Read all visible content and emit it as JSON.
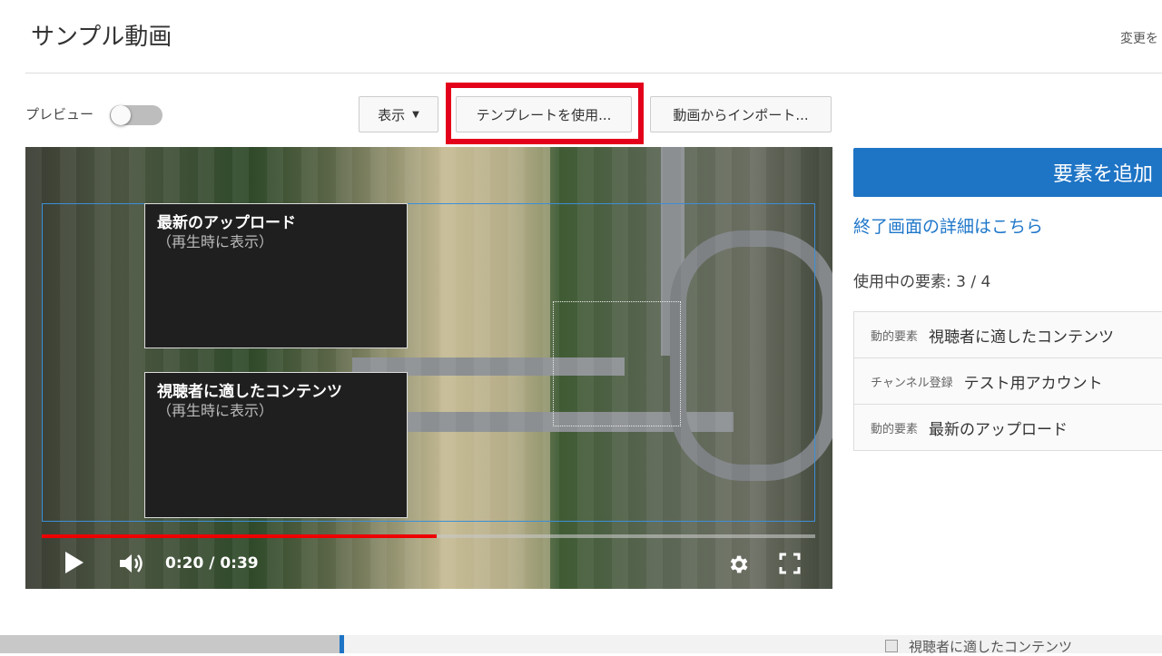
{
  "header": {
    "title": "サンプル動画",
    "right_text": "変更を"
  },
  "toolbar": {
    "preview_label": "プレビュー",
    "preview_enabled": false,
    "show_label": "表示",
    "template_label": "テンプレートを使用...",
    "import_label": "動画からインポート..."
  },
  "video": {
    "elements": [
      {
        "title": "最新のアップロード",
        "subtitle": "（再生時に表示）"
      },
      {
        "title": "視聴者に適したコンテンツ",
        "subtitle": "（再生時に表示）"
      }
    ],
    "time": "0:20 / 0:39",
    "progress": 0.51
  },
  "sidebar": {
    "add_button": "要素を追加",
    "details_link": "終了画面の詳細はこちら",
    "usage": "使用中の要素: 3 / 4",
    "items": [
      {
        "type": "動的要素",
        "name": "視聴者に適したコンテンツ"
      },
      {
        "type": "チャンネル登録",
        "name": "テスト用アカウント"
      },
      {
        "type": "動的要素",
        "name": "最新のアップロード"
      }
    ]
  },
  "timeline": {
    "item_label": "視聴者に適したコンテンツ"
  },
  "colors": {
    "accent": "#1e74c5",
    "highlight": "#e3001a",
    "progress": "#ee0000"
  }
}
